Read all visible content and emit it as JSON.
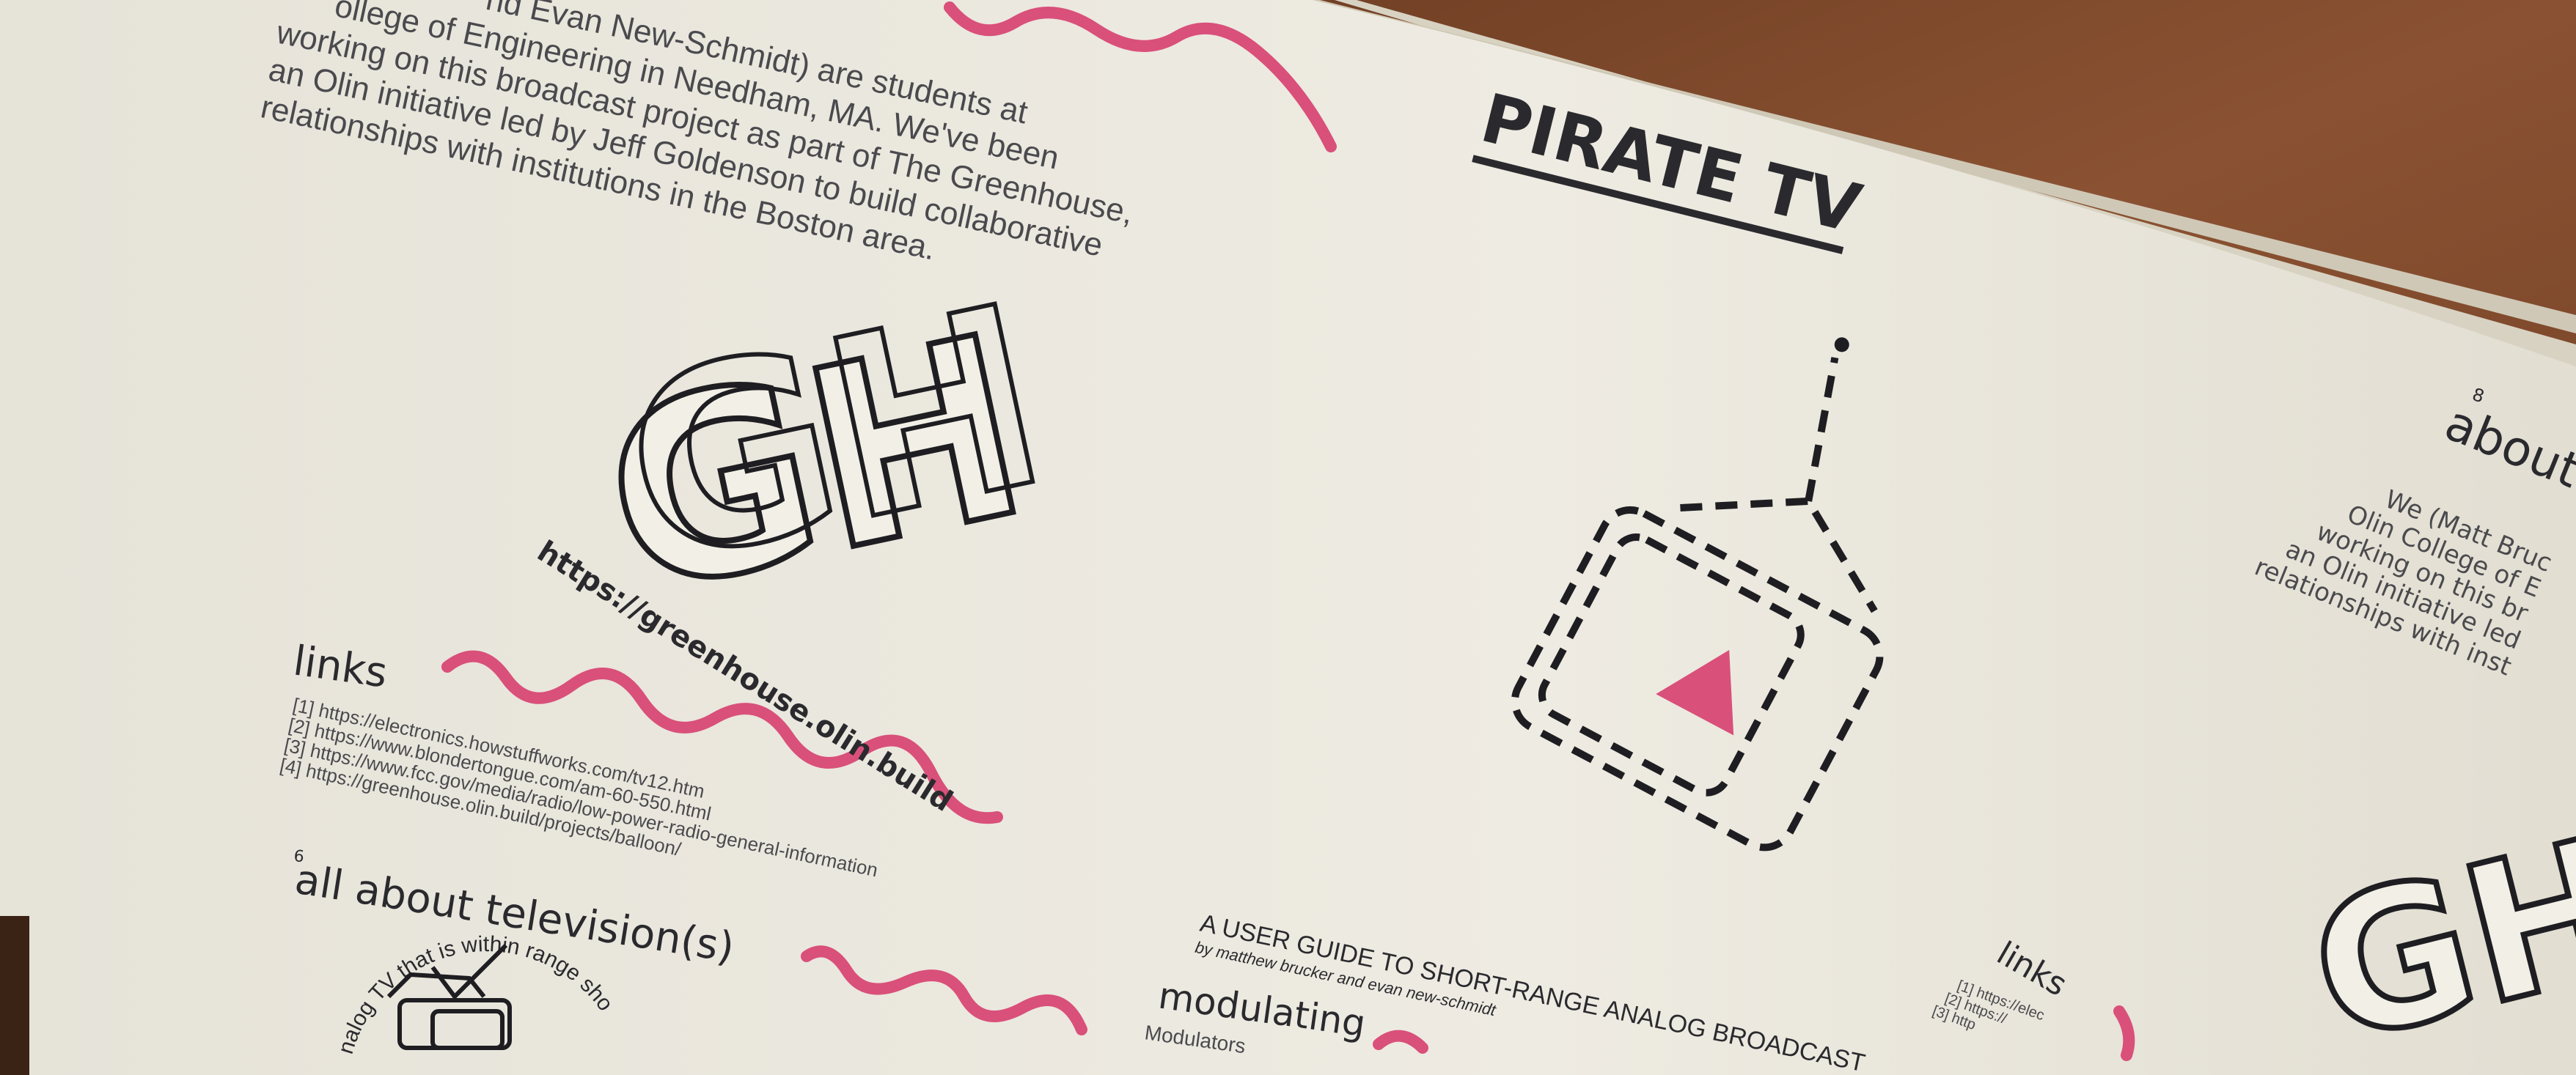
{
  "left_page": {
    "about_paragraph": [
      "nd Evan New-Schmidt) are students at",
      "ollege of Engineering in Needham, MA. We've been",
      "working on this broadcast project as part of The Greenhouse,",
      "an Olin initiative led by Jeff Goldenson to build collaborative",
      "relationships with institutions in the Boston area."
    ],
    "logo_letters": "GH",
    "logo_url": "https://greenhouse.olin.build",
    "links_heading": "links",
    "links": [
      "[1] https://electronics.howstuffworks.com/tv12.htm",
      "[2] https://www.blondertongue.com/am-60-550.html",
      "[3] https://www.fcc.gov/media/radio/low-power-radio-general-information",
      "[4] https://greenhouse.olin.build/projects/balloon/"
    ],
    "section_number": "6",
    "section_heading": "all about television(s)",
    "circle_caption": "nalog TV that is within range should be capable"
  },
  "cover": {
    "title": "PIRATE TV",
    "subtitle": "A USER GUIDE TO SHORT-RANGE ANALOG BROADCAST",
    "byline": "by matthew brucker and evan new-schmidt",
    "next_heading": "modulating",
    "next_text": "Modulators"
  },
  "right_page": {
    "section_number": "8",
    "heading": "about",
    "paragraph": [
      "We (Matt Bruc",
      "Olin College of E",
      "working on this br",
      "an Olin initiative led",
      "relationships with inst"
    ],
    "links_heading": "links",
    "links": [
      "[1] https://elec",
      "[2] https://",
      "[3] http"
    ]
  },
  "colors": {
    "accent_pink": "#d9507a",
    "ink": "#2a2a2e",
    "paper": "#ece9df",
    "wood": "#7a4528"
  }
}
